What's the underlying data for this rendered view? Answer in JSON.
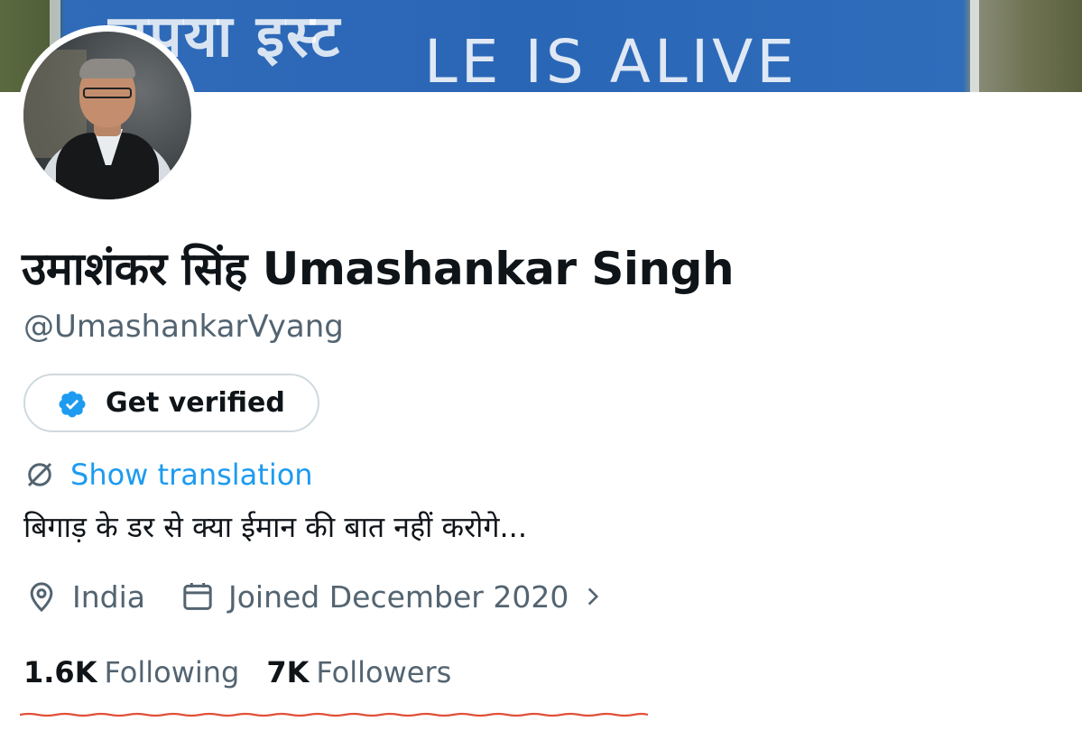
{
  "banner": {
    "sign_text_line1": "लपया इस्ट",
    "sign_text_line2": "LE IS ALIVE"
  },
  "profile": {
    "display_name": "उमाशंकर सिंह Umashankar Singh",
    "handle": "@UmashankarVyang",
    "verify_button_label": "Get verified",
    "show_translation_label": "Show translation",
    "bio": "बिगाड़ के डर से क्या ईमान की बात नहीं करोगे...",
    "location": "India",
    "joined": "Joined December 2020",
    "following_count": "1.6K",
    "following_label": "Following",
    "followers_count": "7K",
    "followers_label": "Followers"
  },
  "icons": {
    "verified_badge": "verified-badge-icon",
    "translate": "translate-globe-icon",
    "location": "location-pin-icon",
    "calendar": "calendar-icon",
    "chevron": "chevron-right-icon"
  },
  "colors": {
    "accent": "#1d9bf0",
    "text_primary": "#0f1419",
    "text_secondary": "#536471",
    "border": "#cfd9de",
    "annotation_underline": "#e0503a"
  }
}
